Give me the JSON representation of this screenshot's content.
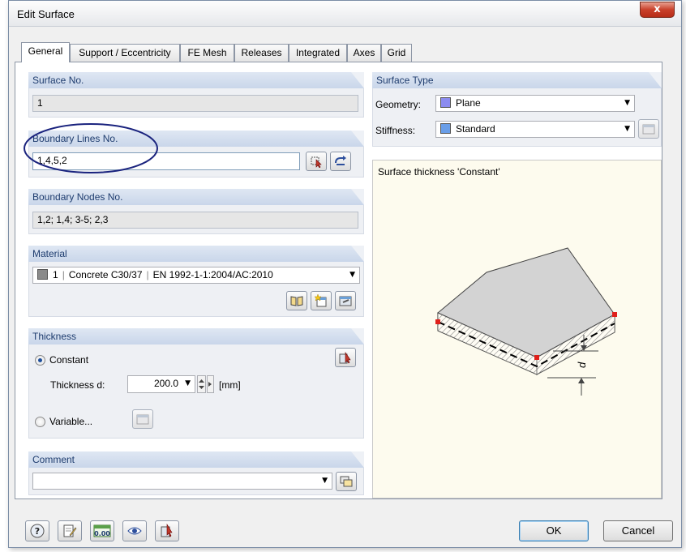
{
  "window": {
    "title": "Edit Surface",
    "close_label": "x"
  },
  "tabs": [
    {
      "label": "General",
      "active": true
    },
    {
      "label": "Support / Eccentricity"
    },
    {
      "label": "FE Mesh"
    },
    {
      "label": "Releases"
    },
    {
      "label": "Integrated"
    },
    {
      "label": "Axes"
    },
    {
      "label": "Grid"
    }
  ],
  "surface_no": {
    "header": "Surface No.",
    "value": "1"
  },
  "boundary_lines": {
    "header": "Boundary Lines No.",
    "value": "1,4,5,2"
  },
  "boundary_nodes": {
    "header": "Boundary Nodes No.",
    "value": "1,2; 1,4; 3-5; 2,3"
  },
  "material": {
    "header": "Material",
    "number": "1",
    "name": "Concrete C30/37",
    "standard": "EN 1992-1-1:2004/AC:2010",
    "swatch_color": "#8a8a8a"
  },
  "thickness": {
    "header": "Thickness",
    "constant_label": "Constant",
    "constant_checked": true,
    "thickness_label": "Thickness d:",
    "thickness_value": "200.0",
    "unit": "[mm]",
    "variable_label": "Variable..."
  },
  "comment": {
    "header": "Comment",
    "value": ""
  },
  "surface_type": {
    "header": "Surface Type",
    "geometry_label": "Geometry:",
    "geometry_value": "Plane",
    "geometry_color": "#8c8cf0",
    "stiffness_label": "Stiffness:",
    "stiffness_value": "Standard",
    "stiffness_color": "#6a9ee8"
  },
  "preview": {
    "title": "Surface thickness 'Constant'",
    "dimension_label": "d"
  },
  "buttons": {
    "ok": "OK",
    "cancel": "Cancel"
  },
  "colors": {
    "accent": "#1e3c6e",
    "highlight_ring": "#1a237e",
    "node_marker": "#e0201b"
  }
}
